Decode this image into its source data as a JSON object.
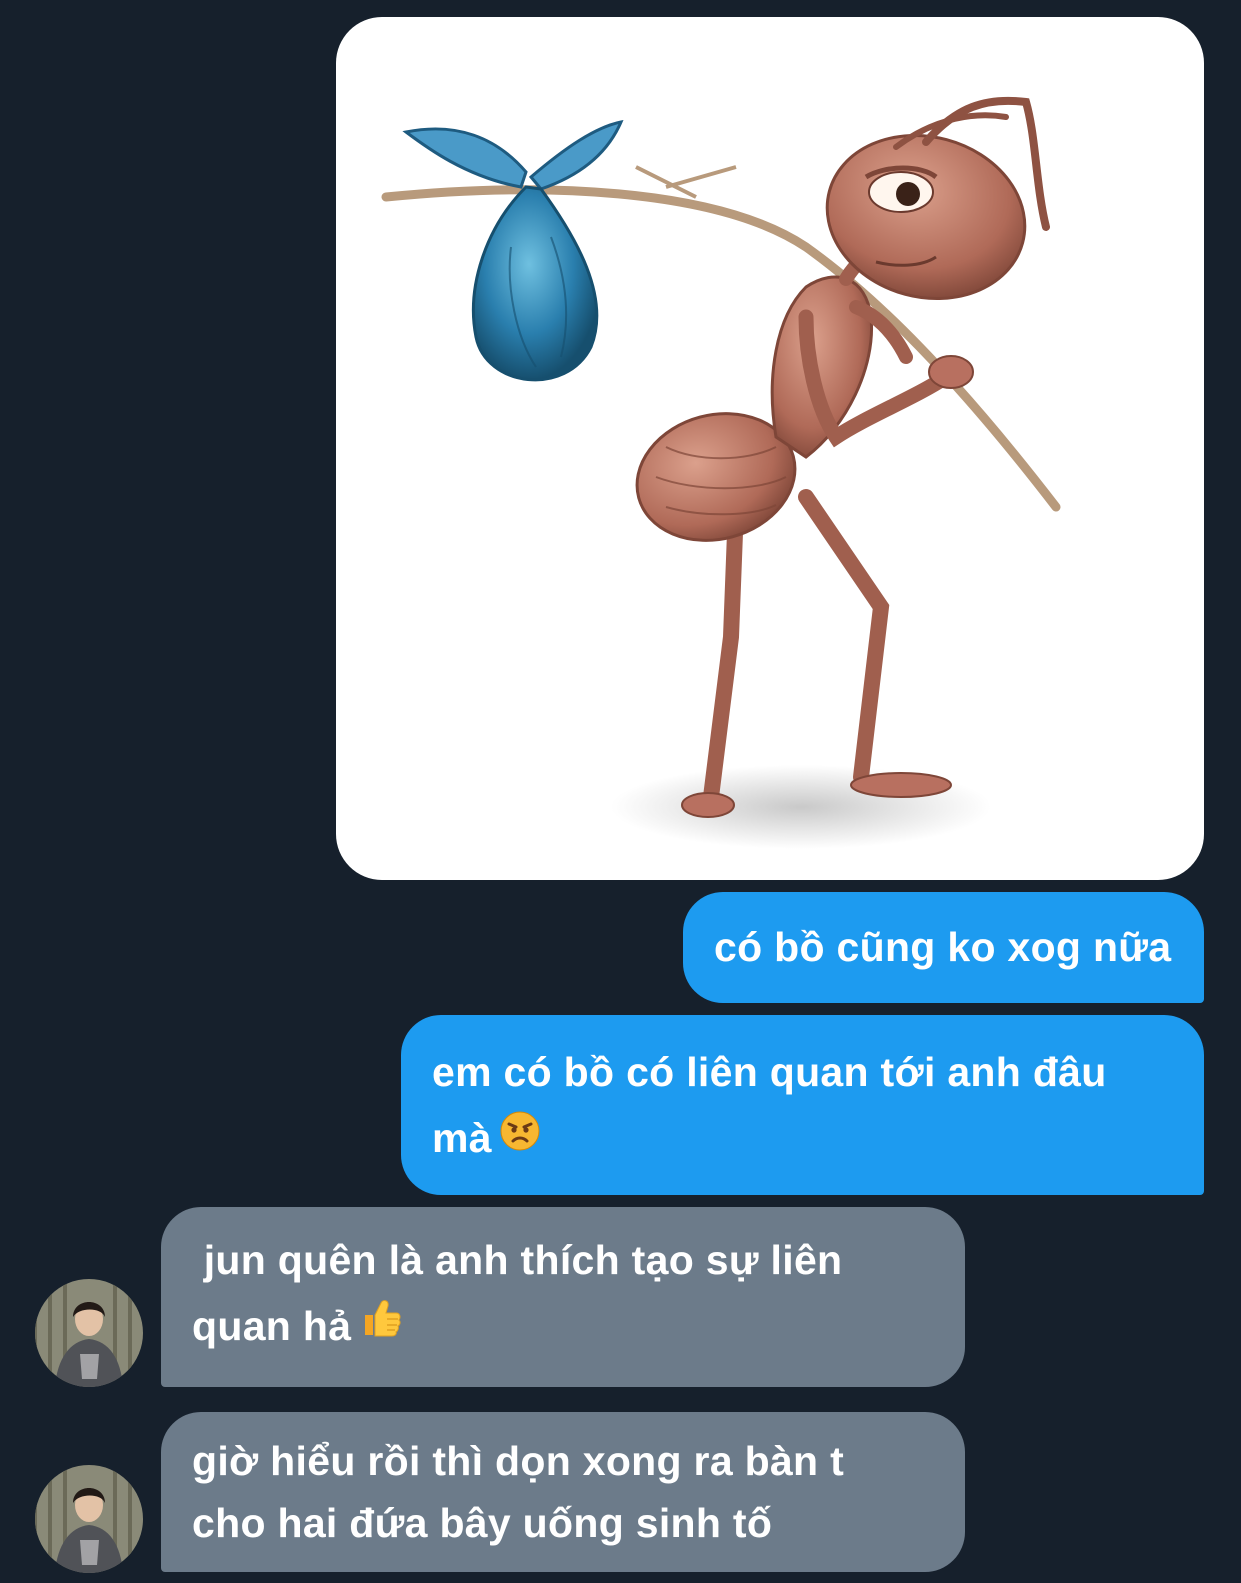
{
  "conversation": {
    "messages": [
      {
        "direction": "outgoing",
        "type": "image",
        "image": "ant-carrying-bundle-sticker"
      },
      {
        "direction": "outgoing",
        "type": "text",
        "lines": [
          "có bồ cũng ko xog nữa"
        ]
      },
      {
        "direction": "outgoing",
        "type": "text",
        "lines": [
          "em có bồ có liên quan tới anh đâu",
          "mà"
        ],
        "emoji": "angry-face-emoji"
      },
      {
        "direction": "incoming",
        "type": "text",
        "lines": [
          " jun quên là anh thích tạo sự liên",
          "quan hả"
        ],
        "emoji": "thumbs-up-emoji"
      },
      {
        "direction": "incoming",
        "type": "text",
        "lines": [
          "giờ hiểu rồi thì dọn xong ra bàn t",
          "cho hai đứa bây uống sinh tố"
        ]
      }
    ]
  },
  "theme": {
    "background": "#16202c",
    "outgoing_bubble": "#1d9bf0",
    "incoming_bubble": "#6c7b8a",
    "text": "#ffffff"
  }
}
